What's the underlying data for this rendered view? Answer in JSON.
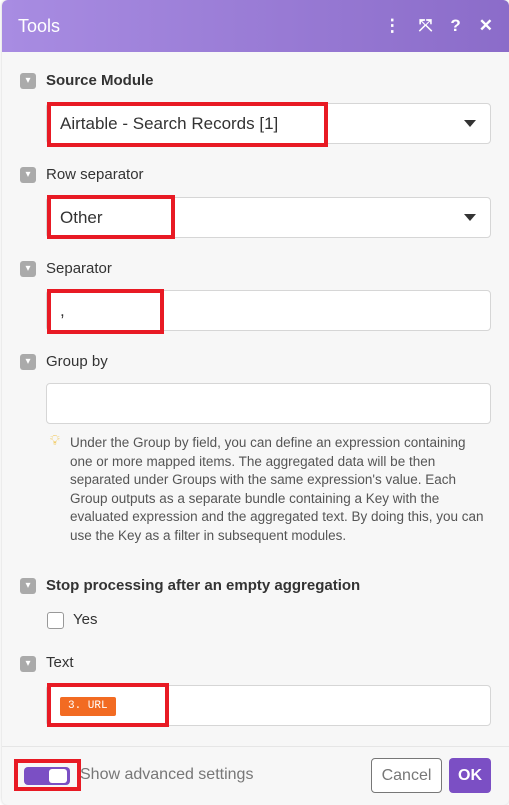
{
  "header": {
    "title": "Tools",
    "icons": [
      "more-vertical-icon",
      "expand-icon",
      "help-icon",
      "close-icon"
    ]
  },
  "fields": {
    "source_module": {
      "label": "Source Module",
      "value": "Airtable - Search Records [1]"
    },
    "row_separator": {
      "label": "Row separator",
      "value": "Other"
    },
    "separator": {
      "label": "Separator",
      "value": ","
    },
    "group_by": {
      "label": "Group by",
      "value": "",
      "hint": "Under the Group by field, you can define an expression containing one or more mapped items. The aggregated data will be then separated under Groups with the same expression's value. Each Group outputs as a separate bundle containing a Key with the evaluated expression and the aggregated text. By doing this, you can use the Key as a filter in subsequent modules."
    },
    "stop_processing": {
      "label": "Stop processing after an empty aggregation",
      "option": "Yes",
      "checked": false
    },
    "text": {
      "label": "Text",
      "token": "3. URL"
    }
  },
  "footer": {
    "advanced_label": "Show advanced settings",
    "advanced_on": true,
    "cancel": "Cancel",
    "ok": "OK"
  },
  "colors": {
    "accent": "#7b4fc4",
    "token": "#f26b22",
    "highlight": "#e81a24"
  }
}
